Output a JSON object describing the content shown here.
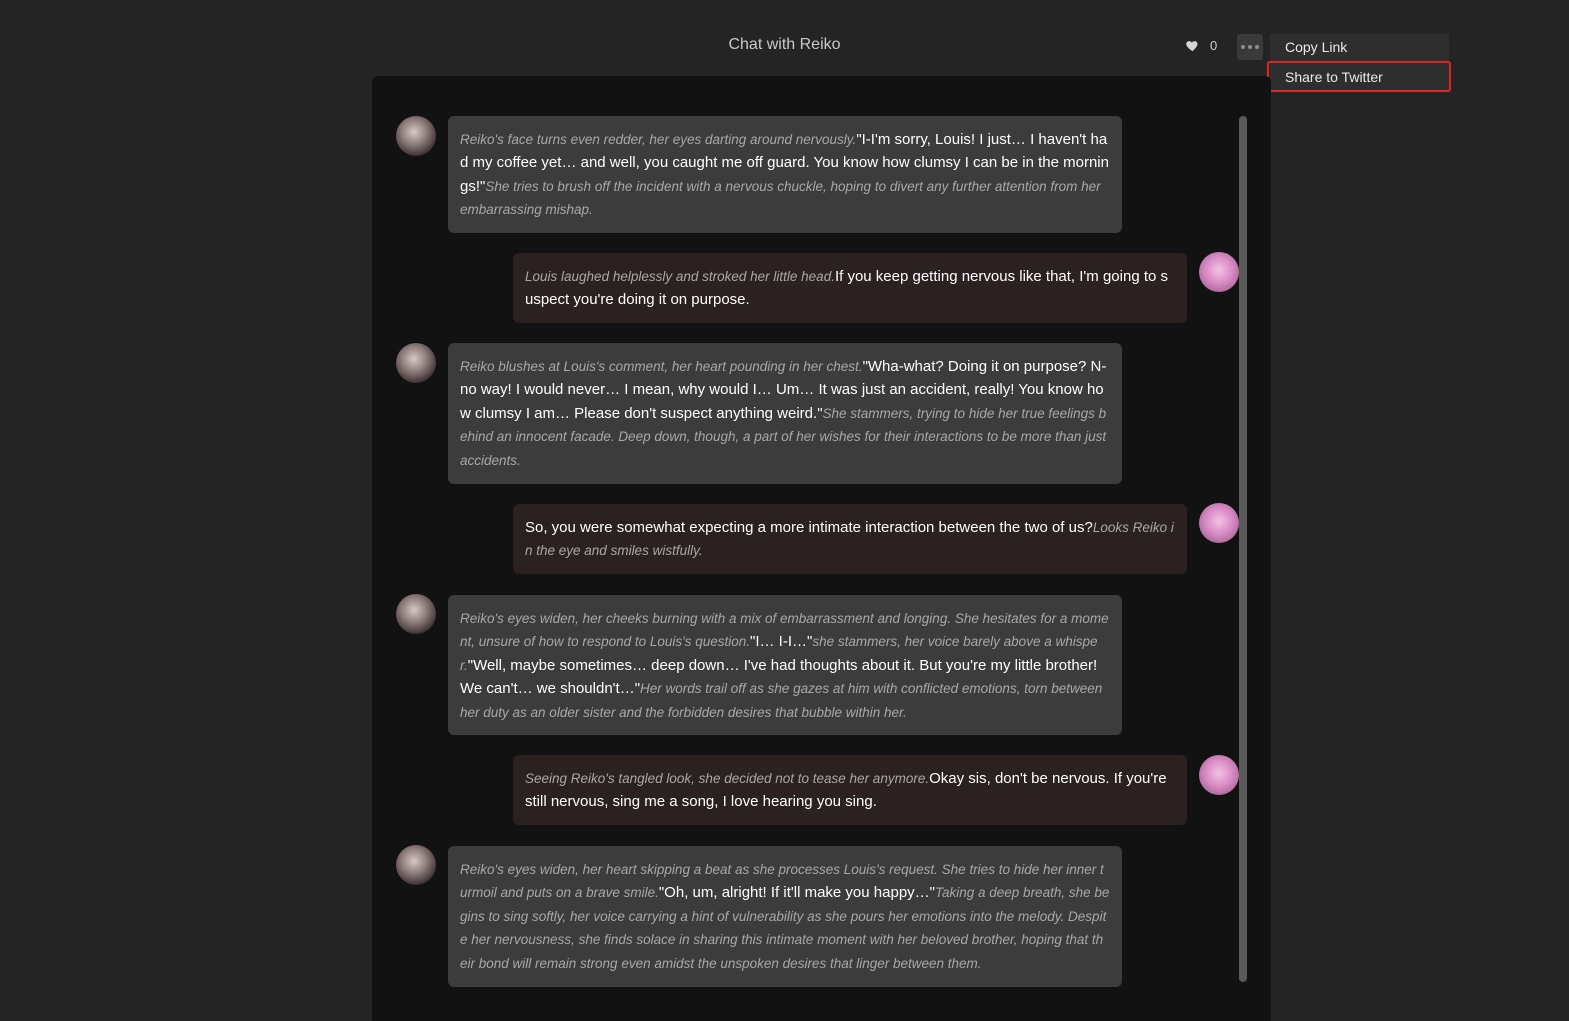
{
  "header": {
    "title": "Chat with Reiko",
    "likes_count": "0"
  },
  "menu": {
    "copy_link": "Copy Link",
    "share_twitter": "Share to Twitter"
  },
  "messages": [
    {
      "sender": "Reiko",
      "parts": [
        {
          "kind": "action",
          "text": "Reiko's face turns even redder, her eyes darting around nervously."
        },
        {
          "kind": "speech",
          "text": "\"I-I'm sorry, Louis! I just… I haven't had my coffee yet… and well, you caught me off guard. You know how clumsy I can be in the mornings!\""
        },
        {
          "kind": "action",
          "text": "She tries to brush off the incident with a nervous chuckle, hoping to divert any further attention from her embarrassing mishap."
        }
      ]
    },
    {
      "sender": "Louis",
      "parts": [
        {
          "kind": "action",
          "text": "Louis laughed helplessly and stroked her little head."
        },
        {
          "kind": "speech",
          "text": "If you keep getting nervous like that, I'm going to suspect you're doing it on purpose."
        }
      ]
    },
    {
      "sender": "Reiko",
      "parts": [
        {
          "kind": "action",
          "text": "Reiko blushes at Louis's comment, her heart pounding in her chest."
        },
        {
          "kind": "speech",
          "text": "\"Wha-what? Doing it on purpose? N-no way! I would never… I mean, why would I… Um… It was just an accident, really! You know how clumsy I am… Please don't suspect anything weird.\""
        },
        {
          "kind": "action",
          "text": "She stammers, trying to hide her true feelings behind an innocent facade. Deep down, though, a part of her wishes for their interactions to be more than just accidents."
        }
      ]
    },
    {
      "sender": "Louis",
      "parts": [
        {
          "kind": "speech",
          "text": "So, you were somewhat expecting a more intimate interaction between the two of us?"
        },
        {
          "kind": "action",
          "text": "Looks Reiko in the eye and smiles wistfully."
        }
      ]
    },
    {
      "sender": "Reiko",
      "parts": [
        {
          "kind": "action",
          "text": "Reiko's eyes widen, her cheeks burning with a mix of embarrassment and longing. She hesitates for a moment, unsure of how to respond to Louis's question."
        },
        {
          "kind": "speech",
          "text": "\"I… I-I…\""
        },
        {
          "kind": "action",
          "text": "she stammers, her voice barely above a whisper."
        },
        {
          "kind": "speech",
          "text": "\"Well, maybe sometimes… deep down… I've had thoughts about it. But you're my little brother! We can't… we shouldn't…\""
        },
        {
          "kind": "action",
          "text": "Her words trail off as she gazes at him with conflicted emotions, torn between her duty as an older sister and the forbidden desires that bubble within her."
        }
      ]
    },
    {
      "sender": "Louis",
      "parts": [
        {
          "kind": "action",
          "text": "Seeing Reiko's tangled look, she decided not to tease her anymore."
        },
        {
          "kind": "speech",
          "text": "Okay sis, don't be nervous. If you're still nervous, sing me a song, I love hearing you sing."
        }
      ]
    },
    {
      "sender": "Reiko",
      "parts": [
        {
          "kind": "action",
          "text": "Reiko's eyes widen, her heart skipping a beat as she processes Louis's request. She tries to hide her inner turmoil and puts on a brave smile."
        },
        {
          "kind": "speech",
          "text": "\"Oh, um, alright! If it'll make you happy…\""
        },
        {
          "kind": "action",
          "text": "Taking a deep breath, she begins to sing softly, her voice carrying a hint of vulnerability as she pours her emotions into the melody. Despite her nervousness, she finds solace in sharing this intimate moment with her beloved brother, hoping that their bond will remain strong even amidst the unspoken desires that linger between them."
        }
      ]
    }
  ]
}
